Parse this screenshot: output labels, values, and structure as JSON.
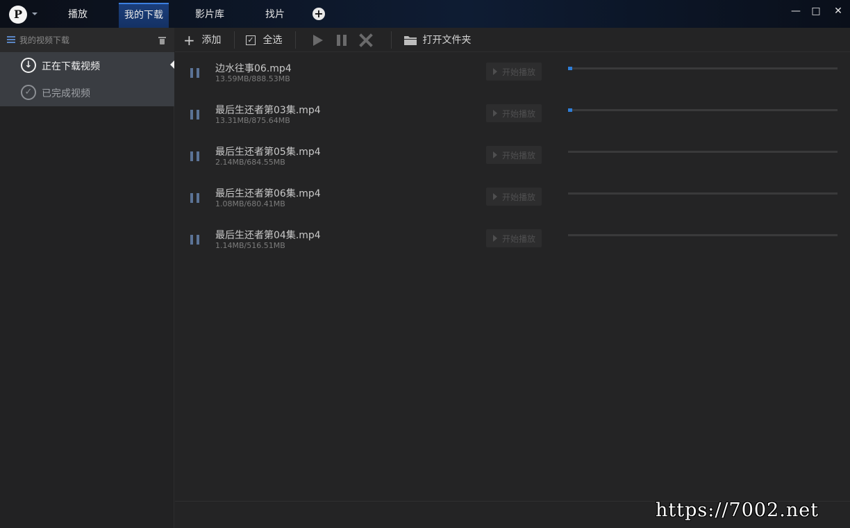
{
  "titlebar": {
    "logo_letter": "P",
    "tabs": [
      {
        "label": "播放",
        "active": false
      },
      {
        "label": "我的下载",
        "active": true
      },
      {
        "label": "影片库",
        "active": false
      },
      {
        "label": "找片",
        "active": false
      }
    ],
    "add_tab": "+",
    "window_controls": {
      "minimize": "—",
      "maximize": "□",
      "close": "✕"
    }
  },
  "sidebar": {
    "header_label": "我的视频下载",
    "items": [
      {
        "label": "正在下载视频",
        "icon": "download-circle-icon",
        "selected": true
      },
      {
        "label": "已完成视频",
        "icon": "check-circle-icon",
        "selected": false
      }
    ]
  },
  "toolbar": {
    "add_label": "添加",
    "select_all_label": "全选",
    "open_folder_label": "打开文件夹"
  },
  "downloads": [
    {
      "name": "边水往事06.mp4",
      "size": "13.59MB/888.53MB",
      "progress": 0.0153,
      "play_label": "开始播放"
    },
    {
      "name": "最后生还者第03集.mp4",
      "size": "13.31MB/875.64MB",
      "progress": 0.0152,
      "play_label": "开始播放"
    },
    {
      "name": "最后生还者第05集.mp4",
      "size": "2.14MB/684.55MB",
      "progress": 0.0031,
      "play_label": "开始播放"
    },
    {
      "name": "最后生还者第06集.mp4",
      "size": "1.08MB/680.41MB",
      "progress": 0.0016,
      "play_label": "开始播放"
    },
    {
      "name": "最后生还者第04集.mp4",
      "size": "1.14MB/516.51MB",
      "progress": 0.0022,
      "play_label": "开始播放"
    }
  ],
  "watermark": "https://7002.net",
  "colors": {
    "accent": "#2f7ed8",
    "active_tab": "#143164",
    "background": "#242425"
  }
}
